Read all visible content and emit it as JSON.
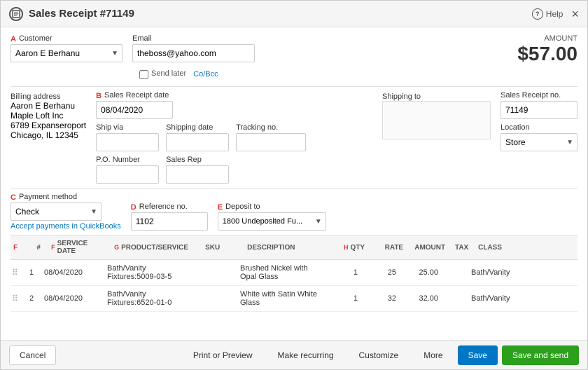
{
  "header": {
    "icon": "receipt",
    "title": "Sales Receipt #71149",
    "help_label": "Help",
    "close_label": "×"
  },
  "annotations": {
    "a": "A",
    "b": "B",
    "c": "C",
    "d": "D",
    "e": "E",
    "f": "F",
    "g": "G",
    "h": "H"
  },
  "customer": {
    "label": "Customer",
    "value": "Aaron E Berhanu"
  },
  "email": {
    "label": "Email",
    "value": "theboss@yahoo.com"
  },
  "amount": {
    "label": "AMOUNT",
    "value": "$57.00"
  },
  "send_label": {
    "checkbox_label": "Send later",
    "or_link": "Co/Bcc"
  },
  "billing_address": {
    "label": "Billing address",
    "lines": [
      "Aaron E Berhanu",
      "Maple Loft Inc",
      "6789 Expanseroport",
      "Chicago, IL 12345"
    ]
  },
  "shipping_to": {
    "label": "Shipping to",
    "value": ""
  },
  "sales_receipt_date": {
    "label": "Sales Receipt date",
    "annotation": "B",
    "value": "08/04/2020"
  },
  "ship_via": {
    "label": "Ship via",
    "value": ""
  },
  "shipping_date": {
    "label": "Shipping date",
    "value": ""
  },
  "tracking_no": {
    "label": "Tracking no.",
    "value": ""
  },
  "po_number": {
    "label": "P.O. Number",
    "value": ""
  },
  "sales_rep": {
    "label": "Sales Rep",
    "value": ""
  },
  "sales_receipt_no": {
    "label": "Sales Receipt no.",
    "value": "71149"
  },
  "location": {
    "label": "Location",
    "value": "Store"
  },
  "payment_method": {
    "label": "Payment method",
    "annotation": "C",
    "value": "Check"
  },
  "reference_no": {
    "label": "Reference no.",
    "annotation": "D",
    "value": "1102"
  },
  "deposit_to": {
    "label": "Deposit to",
    "annotation": "E",
    "value": "1800 Undeposited Fu..."
  },
  "accept_payments": {
    "text": "Accept payments in QuickBooks"
  },
  "table": {
    "columns": [
      {
        "key": "drag",
        "label": "",
        "class": "col-drag"
      },
      {
        "key": "num",
        "label": "#",
        "class": "col-num center"
      },
      {
        "key": "service_date",
        "label": "SERVICE DATE",
        "class": "col-service-date"
      },
      {
        "key": "product",
        "label": "PRODUCT/SERVICE",
        "class": "col-product"
      },
      {
        "key": "sku",
        "label": "SKU",
        "class": "col-sku"
      },
      {
        "key": "description",
        "label": "DESCRIPTION",
        "class": "col-desc"
      },
      {
        "key": "qty",
        "label": "QTY",
        "class": "col-qty right"
      },
      {
        "key": "rate",
        "label": "RATE",
        "class": "col-rate right"
      },
      {
        "key": "amount",
        "label": "AMOUNT",
        "class": "col-amount right"
      },
      {
        "key": "tax",
        "label": "TAX",
        "class": "col-tax center"
      },
      {
        "key": "class",
        "label": "CLASS",
        "class": "col-class"
      }
    ],
    "rows": [
      {
        "num": "1",
        "service_date": "08/04/2020",
        "product": "Bath/Vanity Fixtures:5009-03-5",
        "sku": "",
        "description": "Brushed Nickel with Opal Glass",
        "qty": "1",
        "rate": "25",
        "amount": "25.00",
        "tax": "",
        "class": "Bath/Vanity"
      },
      {
        "num": "2",
        "service_date": "08/04/2020",
        "product": "Bath/Vanity Fixtures:6520-01-0",
        "sku": "",
        "description": "White with Satin White Glass",
        "qty": "1",
        "rate": "32",
        "amount": "32.00",
        "tax": "",
        "class": "Bath/Vanity"
      }
    ]
  },
  "footer": {
    "cancel": "Cancel",
    "print_preview": "Print or Preview",
    "make_recurring": "Make recurring",
    "customize": "Customize",
    "more": "More",
    "save": "Save",
    "save_and_send": "Save and send"
  }
}
